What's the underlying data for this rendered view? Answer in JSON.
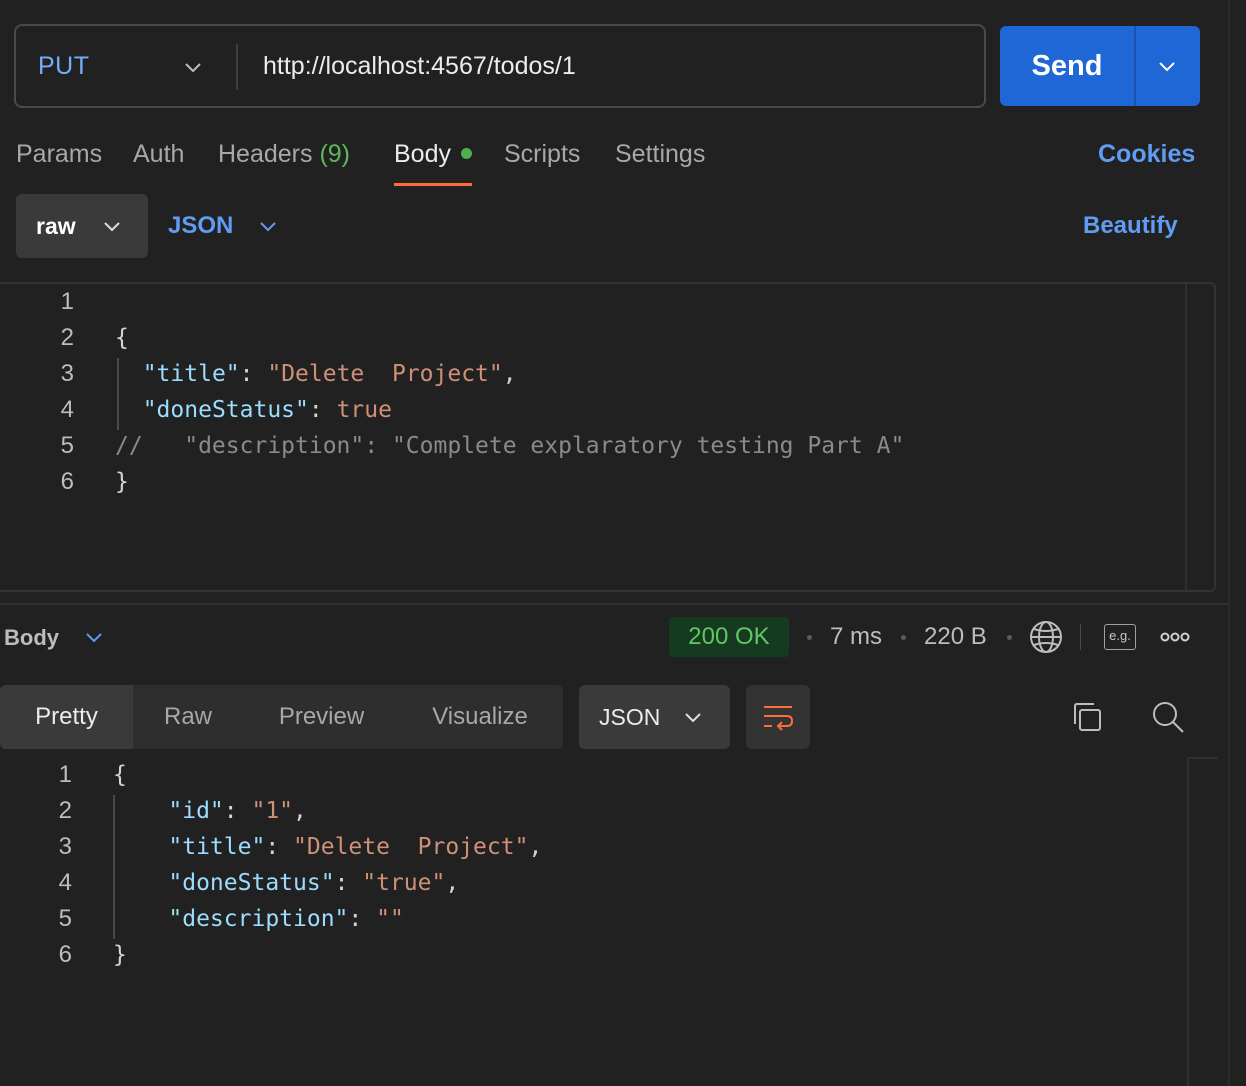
{
  "request": {
    "method": "PUT",
    "url": "http://localhost:4567/todos/1",
    "send_label": "Send"
  },
  "tabs": {
    "params": "Params",
    "auth": "Auth",
    "headers": "Headers",
    "headers_count": "(9)",
    "body": "Body",
    "scripts": "Scripts",
    "settings": "Settings",
    "cookies": "Cookies"
  },
  "body_options": {
    "mode": "raw",
    "language": "JSON",
    "beautify": "Beautify"
  },
  "editor": {
    "line_numbers": [
      "1",
      "2",
      "3",
      "4",
      "5",
      "6"
    ]
  },
  "response": {
    "section_label": "Body",
    "status": "200 OK",
    "time": "7 ms",
    "size": "220 B",
    "eg_label": "e.g.",
    "view_tabs": [
      "Pretty",
      "Raw",
      "Preview",
      "Visualize"
    ],
    "format": "JSON",
    "line_numbers": [
      "1",
      "2",
      "3",
      "4",
      "5",
      "6"
    ]
  },
  "colors": {
    "accent_blue": "#1f66d6",
    "tab_underline": "#ff6c37",
    "status_green": "#61c765",
    "link_blue": "#5f9cf2"
  }
}
